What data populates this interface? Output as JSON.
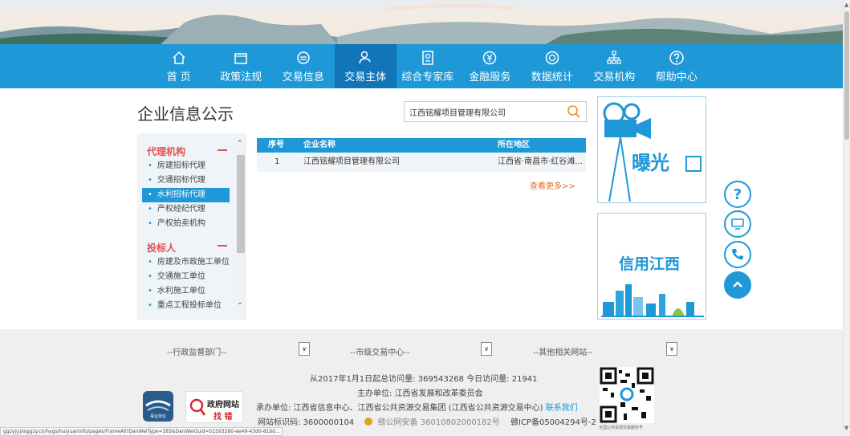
{
  "nav": {
    "items": [
      {
        "label": "首 页",
        "icon": "home-icon"
      },
      {
        "label": "政策法规",
        "icon": "folder-icon"
      },
      {
        "label": "交易信息",
        "icon": "circle-lines-icon"
      },
      {
        "label": "交易主体",
        "icon": "user-icon",
        "active": true
      },
      {
        "label": "综合专家库",
        "icon": "id-card-icon"
      },
      {
        "label": "金融服务",
        "icon": "yen-icon"
      },
      {
        "label": "数据统计",
        "icon": "chart-icon"
      },
      {
        "label": "交易机构",
        "icon": "org-icon"
      },
      {
        "label": "帮助中心",
        "icon": "question-icon"
      }
    ]
  },
  "main": {
    "title": "企业信息公示",
    "search_value": "江西铭耀项目管理有限公司"
  },
  "sidebar": {
    "groups": [
      {
        "title": "代理机构",
        "items": [
          "房建招标代理",
          "交通招标代理",
          "水利招标代理",
          "产权经纪代理",
          "产权拍卖机构"
        ]
      },
      {
        "title": "投标人",
        "items": [
          "房建及市政施工单位",
          "交通施工单位",
          "水利施工单位",
          "重点工程投标单位"
        ]
      }
    ],
    "active_item": "水利招标代理"
  },
  "table": {
    "headers": {
      "index": "序号",
      "name": "企业名称",
      "region": "所在地区"
    },
    "rows": [
      {
        "index": "1",
        "name": "江西铭耀项目管理有限公司",
        "region": "江西省·南昌市·红谷滩..."
      }
    ],
    "more": "查看更多>>"
  },
  "side_boxes": {
    "exposure": "曝光",
    "credit": "信用江西"
  },
  "float_buttons": [
    "question-icon",
    "monitor-icon",
    "phone-icon",
    "up-arrow-icon"
  ],
  "footer": {
    "selects": [
      "--行政监督部门--",
      "--市级交易中心--",
      "--其他相关网站--"
    ],
    "visits": "从2017年1月1日起总访问量: 369543268 今日访问量: 21941",
    "host": "主办单位: 江西省发展和改革委员会",
    "operator": "承办单位: 江西省信息中心、江西省公共资源交易集团 (江西省公共资源交易中心)",
    "contact": "联系我们",
    "site_id": "网站标识码: 3600000104",
    "police": "赣公网安备 36010802000182号",
    "icp": "赣ICP备05004294号-2",
    "badge_gov_1": "政府网站",
    "badge_gov_2": "找 错",
    "badge_unit": "事业单位",
    "qr_caption": "全国公共资源交易服务号"
  },
  "statusbar": "ggzyjy.jxsggzy.cn/hygs/huiyuaninfo/pages/FrameAll?DanWeiType=183&DanWeiGuid=51593280-ee49-43d0-81bd...",
  "colors": {
    "primary": "#1e98d6",
    "active_nav": "#1175b8",
    "accent_red": "#e35050",
    "more_link": "#e36b2b"
  }
}
